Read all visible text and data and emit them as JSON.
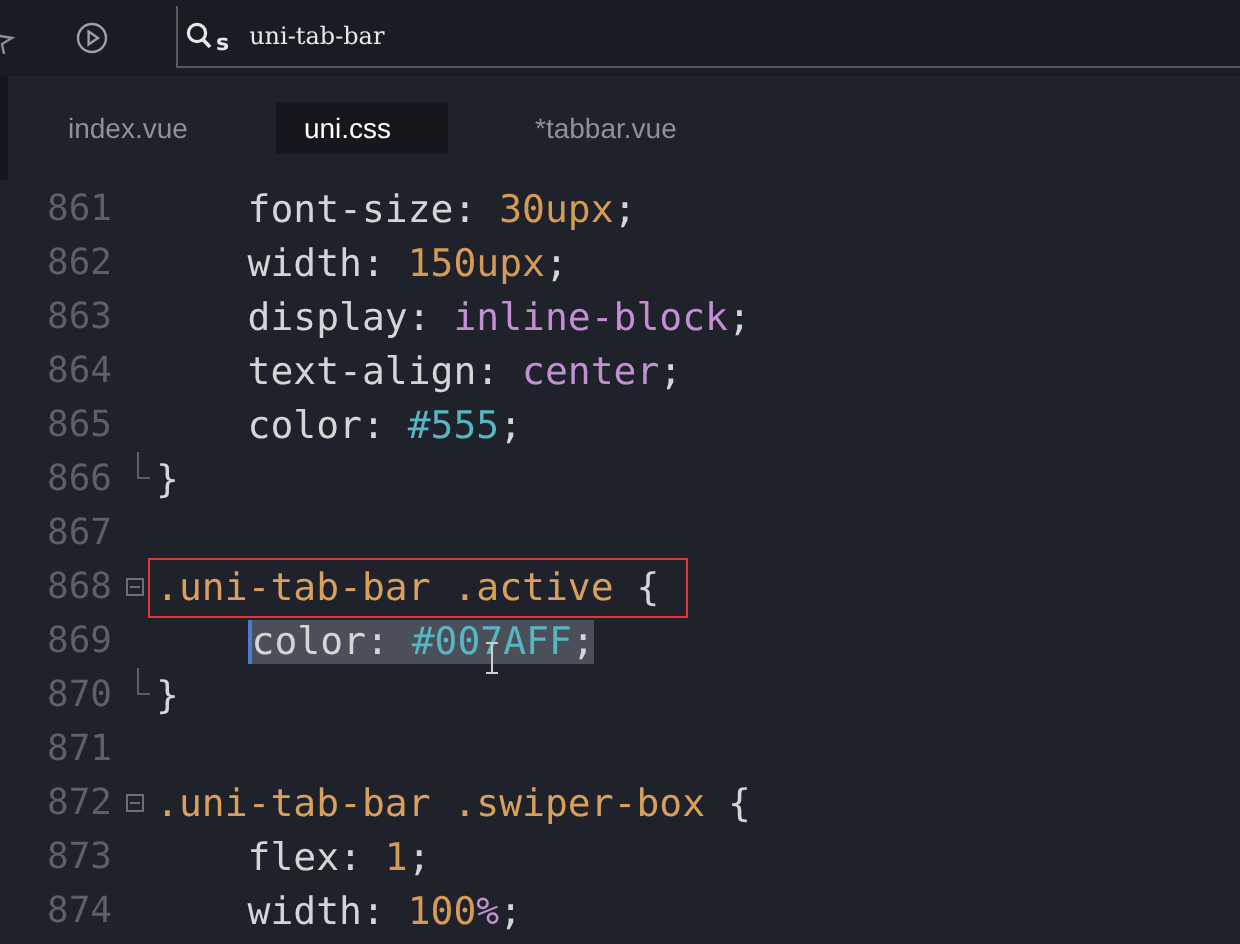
{
  "toolbar": {
    "search": {
      "mode_label": "s",
      "value": "uni-tab-bar"
    }
  },
  "tabs": [
    {
      "label": "index.vue",
      "selected": false
    },
    {
      "label": "uni.css",
      "selected": true
    },
    {
      "label": "*tabbar.vue",
      "selected": false
    }
  ],
  "code_lines": [
    {
      "number": "861",
      "kind": "declaration",
      "tokens": [
        {
          "text": "font-size: ",
          "kind": "prop"
        },
        {
          "text": "30upx",
          "kind": "num"
        },
        {
          "text": ";",
          "kind": "punct"
        }
      ]
    },
    {
      "number": "862",
      "kind": "declaration",
      "tokens": [
        {
          "text": "width: ",
          "kind": "prop"
        },
        {
          "text": "150upx",
          "kind": "num"
        },
        {
          "text": ";",
          "kind": "punct"
        }
      ]
    },
    {
      "number": "863",
      "kind": "declaration",
      "tokens": [
        {
          "text": "display: ",
          "kind": "prop"
        },
        {
          "text": "inline-block",
          "kind": "keyword"
        },
        {
          "text": ";",
          "kind": "punct"
        }
      ]
    },
    {
      "number": "864",
      "kind": "declaration",
      "tokens": [
        {
          "text": "text-align: ",
          "kind": "prop"
        },
        {
          "text": "center",
          "kind": "keyword"
        },
        {
          "text": ";",
          "kind": "punct"
        }
      ]
    },
    {
      "number": "865",
      "kind": "declaration",
      "tokens": [
        {
          "text": "color: ",
          "kind": "prop"
        },
        {
          "text": "#555",
          "kind": "hex"
        },
        {
          "text": ";",
          "kind": "punct"
        }
      ]
    },
    {
      "number": "866",
      "kind": "close",
      "tokens": [
        {
          "text": "}",
          "kind": "punct"
        }
      ]
    },
    {
      "number": "867",
      "kind": "blank"
    },
    {
      "number": "868",
      "kind": "rule",
      "boxed": true,
      "tokens": [
        {
          "text": ".uni-tab-bar .active",
          "kind": "selector"
        },
        {
          "text": " {",
          "kind": "punct"
        }
      ]
    },
    {
      "number": "869",
      "kind": "declaration",
      "selected": true,
      "tokens": [
        {
          "text": "color: ",
          "kind": "prop"
        },
        {
          "text": "#007AFF",
          "kind": "hex"
        },
        {
          "text": ";",
          "kind": "punct"
        }
      ]
    },
    {
      "number": "870",
      "kind": "close",
      "tokens": [
        {
          "text": "}",
          "kind": "punct"
        }
      ]
    },
    {
      "number": "871",
      "kind": "blank"
    },
    {
      "number": "872",
      "kind": "rule",
      "tokens": [
        {
          "text": ".uni-tab-bar .swiper-box",
          "kind": "selector"
        },
        {
          "text": " {",
          "kind": "punct"
        }
      ]
    },
    {
      "number": "873",
      "kind": "declaration",
      "tokens": [
        {
          "text": "flex: ",
          "kind": "prop"
        },
        {
          "text": "1",
          "kind": "num"
        },
        {
          "text": ";",
          "kind": "punct"
        }
      ]
    },
    {
      "number": "874",
      "kind": "declaration",
      "tokens": [
        {
          "text": "width: ",
          "kind": "prop"
        },
        {
          "text": "100",
          "kind": "num"
        },
        {
          "text": "%",
          "kind": "keyword"
        },
        {
          "text": ";",
          "kind": "punct"
        }
      ]
    }
  ]
}
